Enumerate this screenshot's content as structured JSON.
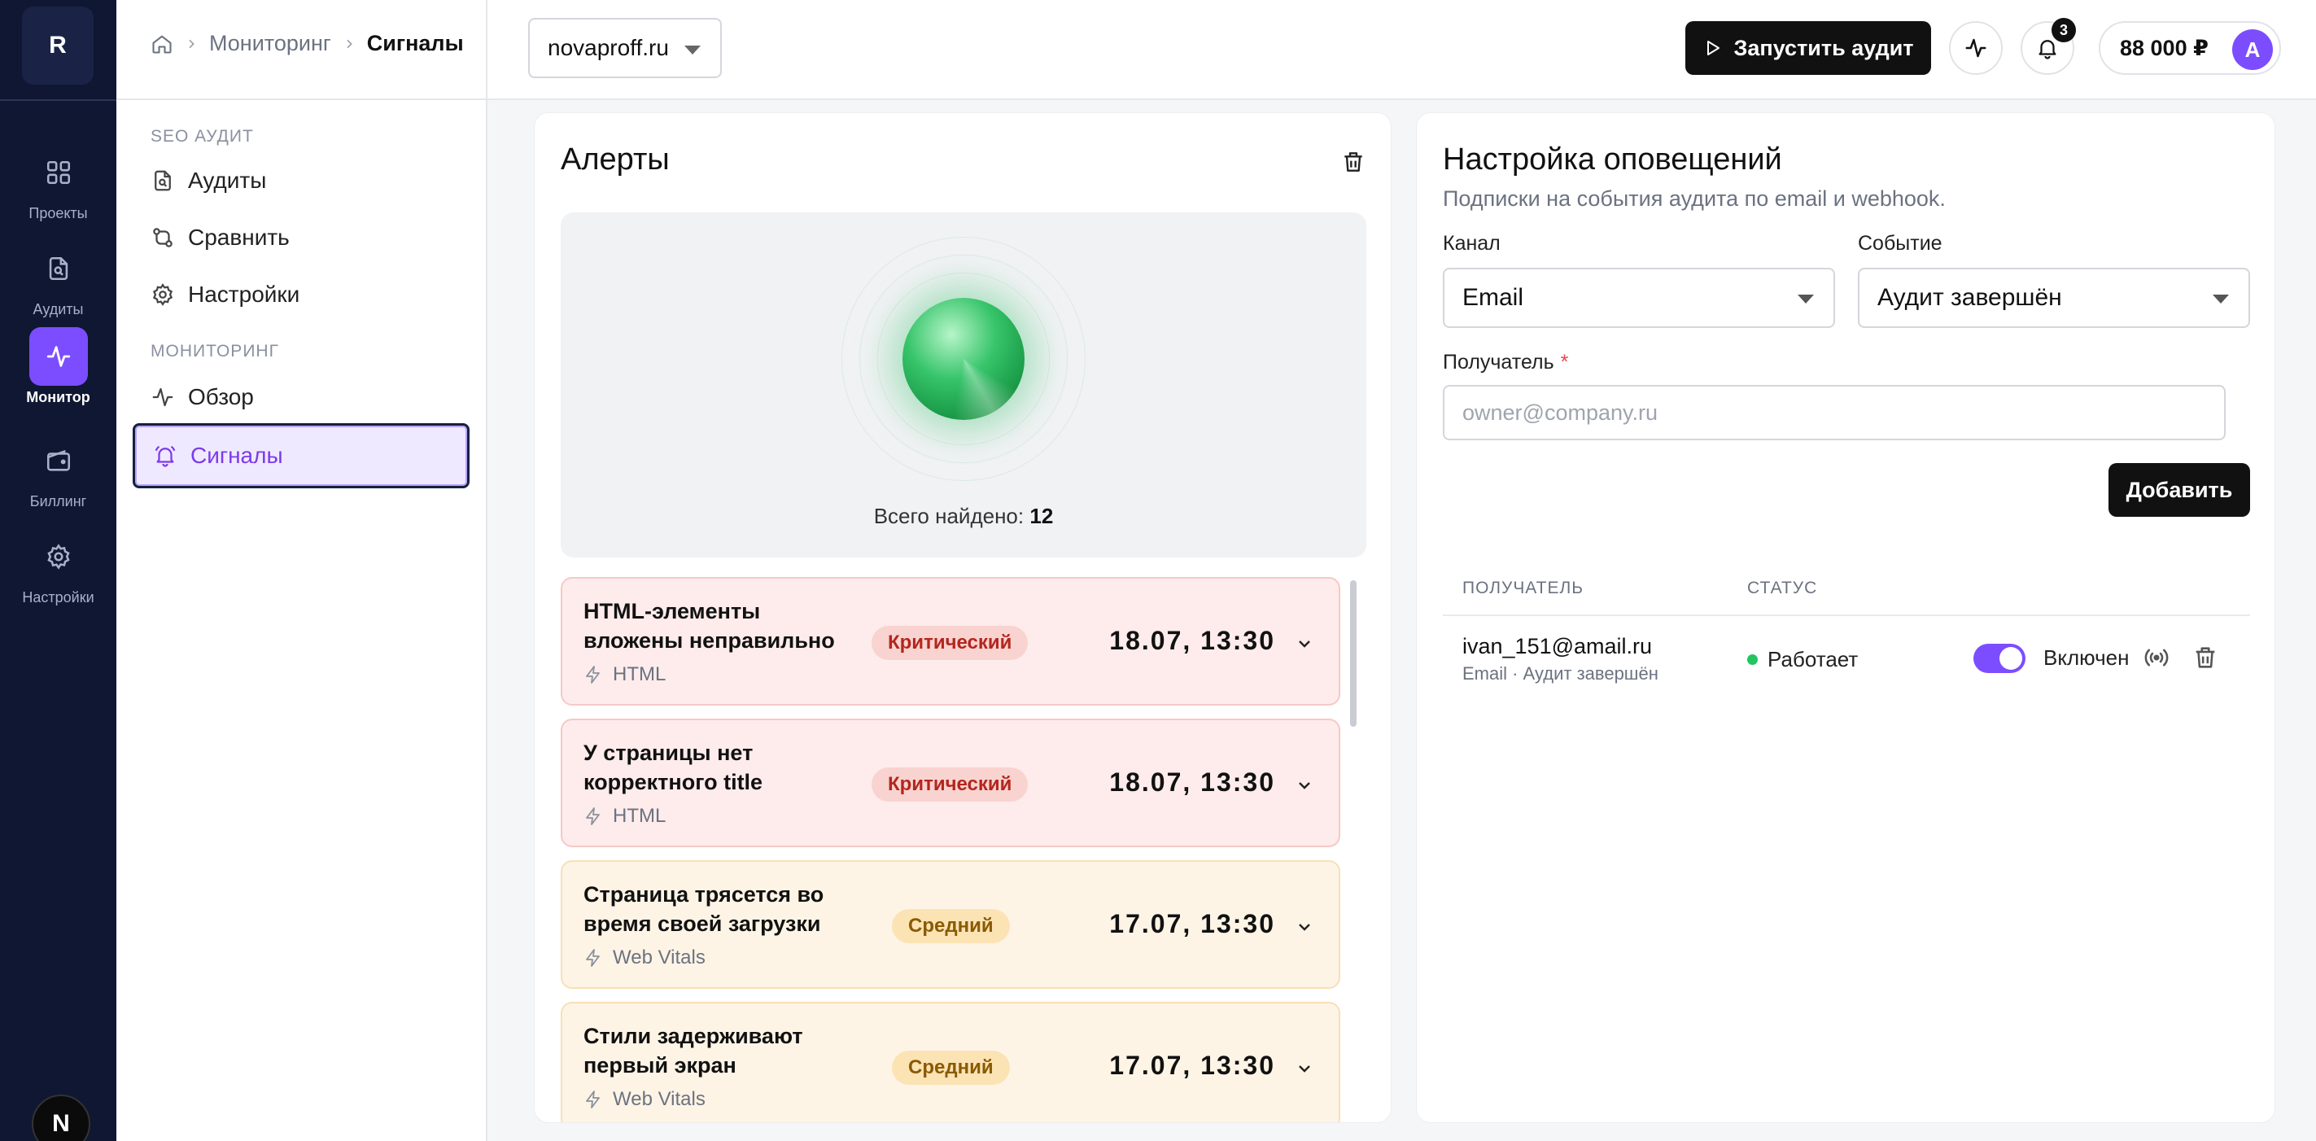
{
  "rail": {
    "logo": "R",
    "items": [
      {
        "label": "Проекты",
        "icon": "grid-icon"
      },
      {
        "label": "Аудиты",
        "icon": "file-search-icon"
      },
      {
        "label": "Монитор",
        "icon": "activity-icon",
        "active": true
      },
      {
        "label": "Биллинг",
        "icon": "wallet-icon"
      },
      {
        "label": "Настройки",
        "icon": "gear-icon"
      }
    ],
    "bottom_badge": "N"
  },
  "breadcrumb": {
    "items": [
      "Мониторинг",
      "Сигналы"
    ]
  },
  "sidebar": {
    "sections": [
      {
        "title": "SEO АУДИТ",
        "items": [
          "Аудиты",
          "Сравнить",
          "Настройки"
        ]
      },
      {
        "title": "МОНИТОРИНГ",
        "items": [
          "Обзор",
          "Сигналы"
        ]
      }
    ],
    "active_item": "Сигналы"
  },
  "header": {
    "site_select": "novaproff.ru",
    "run_audit_label": "Запустить аудит",
    "notifications_count": "3",
    "balance": "88 000 ₽",
    "avatar": "A"
  },
  "alerts": {
    "title": "Алерты",
    "found_label": "Всего найдено:",
    "found_count": "12",
    "items": [
      {
        "title": "HTML-элементы вложены неправильно",
        "category": "HTML",
        "severity": "Критический",
        "level": "critical",
        "time": "18.07, 13:30"
      },
      {
        "title": "У страницы нет корректного title",
        "category": "HTML",
        "severity": "Критический",
        "level": "critical",
        "time": "18.07, 13:30"
      },
      {
        "title": "Страница трясется во время своей загрузки",
        "category": "Web Vitals",
        "severity": "Средний",
        "level": "medium",
        "time": "17.07, 13:30"
      },
      {
        "title": "Стили задерживают первый экран",
        "category": "Web Vitals",
        "severity": "Средний",
        "level": "medium",
        "time": "17.07, 13:30"
      }
    ]
  },
  "notifications": {
    "title": "Настройка оповещений",
    "subtitle": "Подписки на события аудита по email и webhook.",
    "channel_label": "Канал",
    "channel_value": "Email",
    "event_label": "Событие",
    "event_value": "Аудит завершён",
    "recipient_label": "Получатель",
    "recipient_required": "*",
    "recipient_placeholder": "owner@company.ru",
    "add_label": "Добавить",
    "table": {
      "col_recipient": "ПОЛУЧАТЕЛЬ",
      "col_status": "СТАТУС",
      "rows": [
        {
          "email": "ivan_151@amail.ru",
          "meta": "Email · Аудит завершён",
          "status": "Работает",
          "toggle_label": "Включен",
          "enabled": true
        }
      ]
    }
  },
  "colors": {
    "accent": "#7c4dff",
    "rail_bg": "#0f1733",
    "critical_bg": "#fdeceb",
    "medium_bg": "#fef4e6",
    "status_ok": "#22c55e"
  }
}
